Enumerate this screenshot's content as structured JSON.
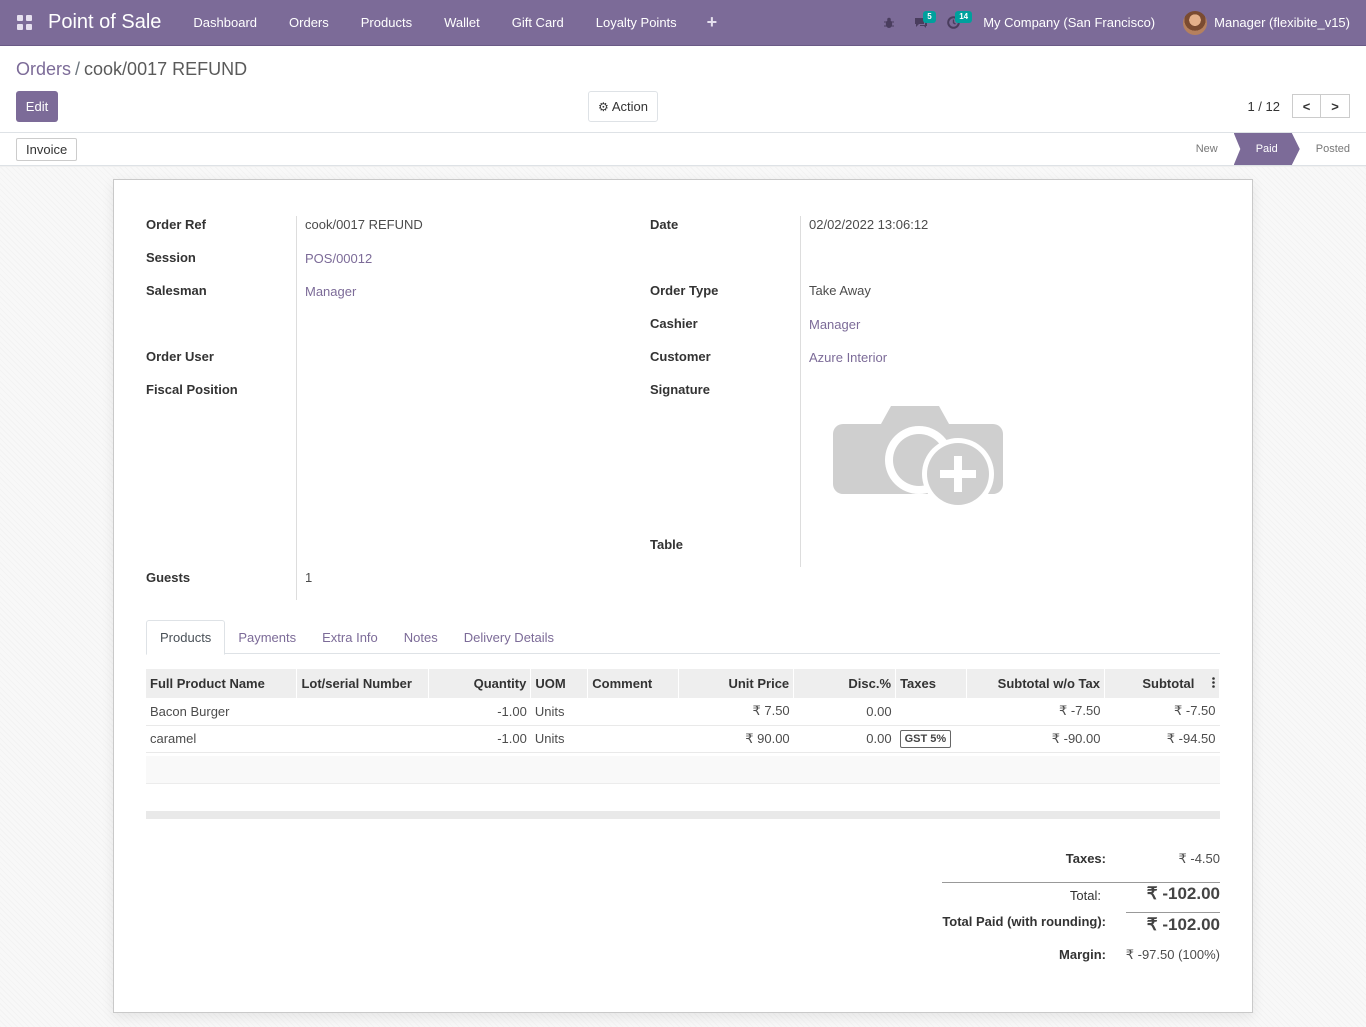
{
  "navbar": {
    "brand": "Point of Sale",
    "menu": [
      "Dashboard",
      "Orders",
      "Products",
      "Wallet",
      "Gift Card",
      "Loyalty Points"
    ],
    "plus": "+",
    "messages_badge": "5",
    "activity_badge": "14",
    "company": "My Company (San Francisco)",
    "user": "Manager (flexibite_v15)"
  },
  "breadcrumb": {
    "parent": "Orders",
    "separator": "/",
    "current": "cook/0017 REFUND"
  },
  "buttons": {
    "edit": "Edit",
    "action": "Action",
    "invoice": "Invoice"
  },
  "pager": {
    "value": "1 / 12",
    "prev": "<",
    "next": ">"
  },
  "stages": {
    "new": "New",
    "paid": "Paid",
    "posted": "Posted"
  },
  "form": {
    "order_ref_label": "Order Ref",
    "order_ref": "cook/0017 REFUND",
    "session_label": "Session",
    "session": "POS/00012",
    "salesman_label": "Salesman",
    "salesman": "Manager",
    "order_user_label": "Order User",
    "fiscal_position_label": "Fiscal Position",
    "guests_label": "Guests",
    "guests": "1",
    "date_label": "Date",
    "date": "02/02/2022 13:06:12",
    "order_type_label": "Order Type",
    "order_type": "Take Away",
    "cashier_label": "Cashier",
    "cashier": "Manager",
    "customer_label": "Customer",
    "customer": "Azure Interior",
    "signature_label": "Signature",
    "table_label": "Table"
  },
  "tabs": [
    "Products",
    "Payments",
    "Extra Info",
    "Notes",
    "Delivery Details"
  ],
  "lines": {
    "headers": [
      "Full Product Name",
      "Lot/serial Number",
      "Quantity",
      "UOM",
      "Comment",
      "Unit Price",
      "Disc.%",
      "Taxes",
      "Subtotal w/o Tax",
      "Subtotal"
    ],
    "rows": [
      {
        "name": "Bacon Burger",
        "lot": "",
        "qty": "-1.00",
        "uom": "Units",
        "comment": "",
        "price": "₹ 7.50",
        "disc": "0.00",
        "taxes": "",
        "subtotal_wo": "₹ -7.50",
        "subtotal": "₹ -7.50"
      },
      {
        "name": "caramel",
        "lot": "",
        "qty": "-1.00",
        "uom": "Units",
        "comment": "",
        "price": "₹ 90.00",
        "disc": "0.00",
        "taxes": "GST 5%",
        "subtotal_wo": "₹ -90.00",
        "subtotal": "₹ -94.50"
      }
    ]
  },
  "totals": {
    "taxes_label": "Taxes:",
    "taxes": "₹ -4.50",
    "total_label": "Total:",
    "total": "₹ -102.00",
    "paid_label": "Total Paid (with rounding):",
    "paid": "₹ -102.00",
    "margin_label": "Margin:",
    "margin": "₹ -97.50 (100%)"
  },
  "colors": {
    "brand": "#7c6b98",
    "badge": "#00A09D"
  }
}
